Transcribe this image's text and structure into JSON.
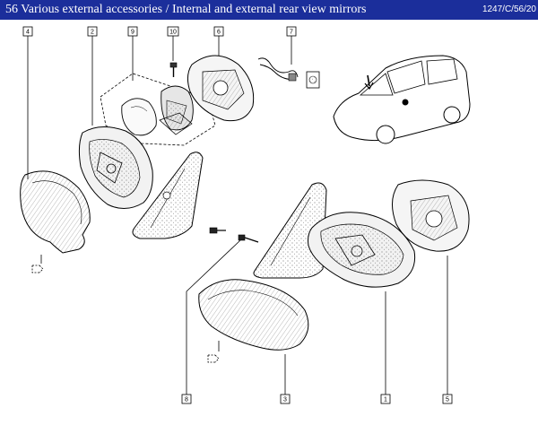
{
  "header": {
    "title": "56 Various external accessories / Internal and external rear view mirrors",
    "reference": "1247/C/56/20"
  },
  "callouts": [
    "4",
    "2",
    "9",
    "10",
    "6",
    "7",
    "8",
    "3",
    "1",
    "5"
  ],
  "colors": {
    "title_bar": "#1b2e9b",
    "title_text": "#ffffff",
    "line": "#000000"
  }
}
